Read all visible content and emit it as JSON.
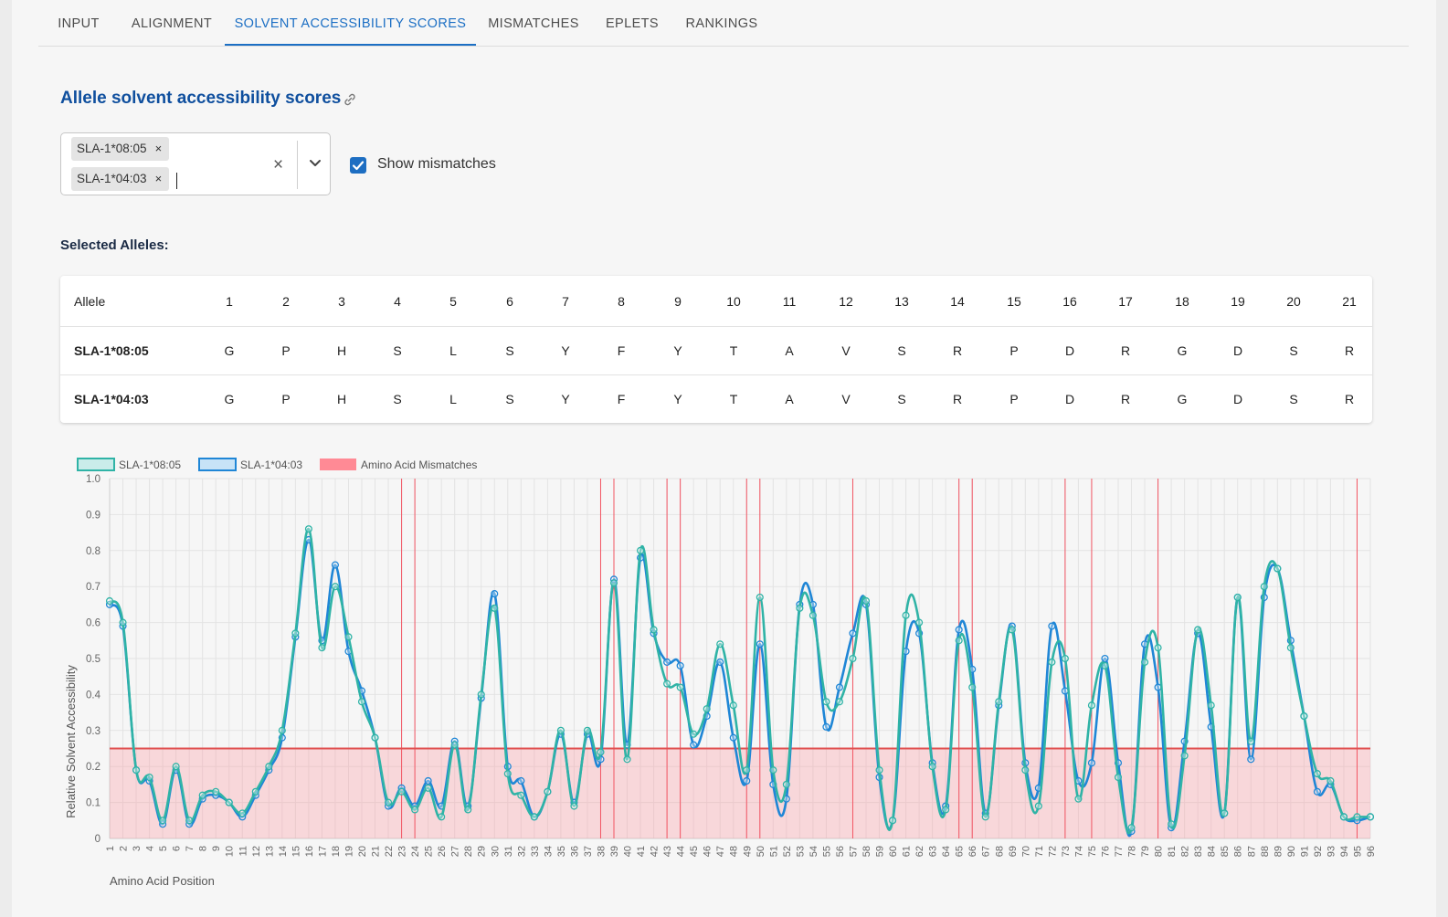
{
  "tabs": [
    "INPUT",
    "ALIGNMENT",
    "SOLVENT ACCESSIBILITY SCORES",
    "MISMATCHES",
    "EPLETS",
    "RANKINGS"
  ],
  "active_tab": "SOLVENT ACCESSIBILITY SCORES",
  "section_title": "Allele solvent accessibility scores",
  "selector": {
    "chips": [
      "SLA-1*08:05",
      "SLA-1*04:03"
    ],
    "clear": "×",
    "remove": "×"
  },
  "show_mismatches": {
    "label": "Show mismatches",
    "checked": true
  },
  "selected_alleles_title": "Selected Alleles:",
  "table": {
    "header_label": "Allele",
    "positions": [
      "1",
      "2",
      "3",
      "4",
      "5",
      "6",
      "7",
      "8",
      "9",
      "10",
      "11",
      "12",
      "13",
      "14",
      "15",
      "16",
      "17",
      "18",
      "19",
      "20",
      "21"
    ],
    "rows": [
      {
        "allele": "SLA-1*08:05",
        "residues": [
          "G",
          "P",
          "H",
          "S",
          "L",
          "S",
          "Y",
          "F",
          "Y",
          "T",
          "A",
          "V",
          "S",
          "R",
          "P",
          "D",
          "R",
          "G",
          "D",
          "S",
          "R"
        ]
      },
      {
        "allele": "SLA-1*04:03",
        "residues": [
          "G",
          "P",
          "H",
          "S",
          "L",
          "S",
          "Y",
          "F",
          "Y",
          "T",
          "A",
          "V",
          "S",
          "R",
          "P",
          "D",
          "R",
          "G",
          "D",
          "S",
          "R"
        ]
      }
    ]
  },
  "colors": {
    "accent": "#1c6fc4",
    "title": "#0f4f9e",
    "series1": "#2fb3a6",
    "series2": "#1f86d6",
    "mismatch": "#ff8a95",
    "threshold": "#e05050"
  },
  "chart_data": {
    "type": "line",
    "xlabel": "Amino Acid Position",
    "ylabel": "Relative Solvent Accessibility",
    "ylim": [
      0,
      1
    ],
    "yticks": [
      "0",
      "0.1",
      "0.2",
      "0.3",
      "0.4",
      "0.5",
      "0.6",
      "0.7",
      "0.8",
      "0.9",
      "1.0"
    ],
    "x": [
      1,
      2,
      3,
      4,
      5,
      6,
      7,
      8,
      9,
      10,
      11,
      12,
      13,
      14,
      15,
      16,
      17,
      18,
      19,
      20,
      21,
      22,
      23,
      24,
      25,
      26,
      27,
      28,
      29,
      30,
      31,
      32,
      33,
      34,
      35,
      36,
      37,
      38,
      39,
      40,
      41,
      42,
      43,
      44,
      45,
      46,
      47,
      48,
      49,
      50,
      51,
      52,
      53,
      54,
      55,
      56,
      57,
      58,
      59,
      60,
      61,
      62,
      63,
      64,
      65,
      66,
      67,
      68,
      69,
      70,
      71,
      72,
      73,
      74,
      75,
      76,
      77,
      78,
      79,
      80,
      81,
      82,
      83,
      84,
      85,
      86,
      87,
      88,
      89,
      90,
      91,
      92,
      93,
      94,
      95,
      96
    ],
    "legend": [
      "SLA-1*08:05",
      "SLA-1*04:03",
      "Amino Acid Mismatches"
    ],
    "legend_position": "top-left",
    "grid": true,
    "threshold": 0.25,
    "mismatch_positions": [
      23,
      24,
      38,
      39,
      43,
      44,
      49,
      50,
      57,
      65,
      66,
      73,
      75,
      80,
      95
    ],
    "series": [
      {
        "name": "SLA-1*08:05",
        "values": [
          0.66,
          0.6,
          0.19,
          0.17,
          0.05,
          0.2,
          0.05,
          0.12,
          0.13,
          0.1,
          0.07,
          0.13,
          0.2,
          0.3,
          0.57,
          0.86,
          0.53,
          0.7,
          0.56,
          0.38,
          0.28,
          0.1,
          0.13,
          0.08,
          0.14,
          0.06,
          0.26,
          0.08,
          0.4,
          0.64,
          0.18,
          0.12,
          0.06,
          0.13,
          0.3,
          0.09,
          0.3,
          0.24,
          0.71,
          0.22,
          0.8,
          0.58,
          0.43,
          0.42,
          0.29,
          0.36,
          0.54,
          0.37,
          0.19,
          0.67,
          0.19,
          0.15,
          0.64,
          0.62,
          0.38,
          0.38,
          0.5,
          0.66,
          0.19,
          0.05,
          0.62,
          0.6,
          0.2,
          0.08,
          0.55,
          0.42,
          0.06,
          0.38,
          0.58,
          0.19,
          0.09,
          0.49,
          0.5,
          0.11,
          0.37,
          0.48,
          0.17,
          0.03,
          0.49,
          0.53,
          0.04,
          0.23,
          0.58,
          0.37,
          0.07,
          0.67,
          0.27,
          0.7,
          0.75,
          0.53,
          0.34,
          0.18,
          0.16,
          0.06,
          0.06,
          0.06
        ]
      },
      {
        "name": "SLA-1*04:03",
        "values": [
          0.65,
          0.59,
          0.19,
          0.16,
          0.04,
          0.19,
          0.04,
          0.11,
          0.12,
          0.1,
          0.06,
          0.12,
          0.19,
          0.28,
          0.56,
          0.83,
          0.55,
          0.76,
          0.52,
          0.41,
          0.28,
          0.09,
          0.14,
          0.09,
          0.16,
          0.09,
          0.27,
          0.09,
          0.39,
          0.68,
          0.2,
          0.16,
          0.06,
          0.13,
          0.29,
          0.1,
          0.29,
          0.22,
          0.72,
          0.26,
          0.78,
          0.57,
          0.49,
          0.48,
          0.26,
          0.34,
          0.49,
          0.28,
          0.16,
          0.54,
          0.15,
          0.11,
          0.65,
          0.65,
          0.31,
          0.42,
          0.57,
          0.65,
          0.17,
          0.05,
          0.52,
          0.57,
          0.21,
          0.09,
          0.58,
          0.47,
          0.07,
          0.37,
          0.59,
          0.21,
          0.14,
          0.59,
          0.41,
          0.16,
          0.21,
          0.5,
          0.21,
          0.02,
          0.54,
          0.42,
          0.03,
          0.27,
          0.57,
          0.31,
          0.07,
          0.67,
          0.22,
          0.67,
          0.75,
          0.55,
          0.34,
          0.13,
          0.15,
          0.06,
          0.05,
          0.06
        ]
      }
    ]
  }
}
